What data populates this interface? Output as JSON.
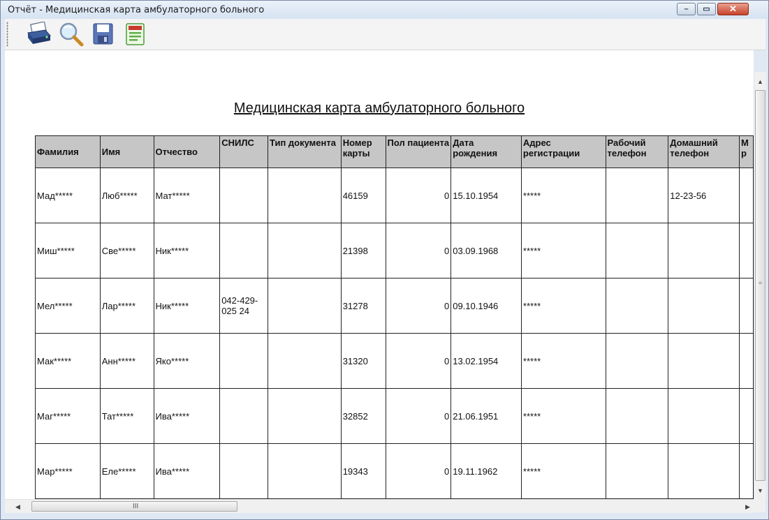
{
  "window": {
    "title": "Отчёт - Медицинская карта амбулаторного больного",
    "min_glyph": "–",
    "max_glyph": "▭",
    "close_glyph": "✕"
  },
  "toolbar": {
    "icons": [
      "printer-icon",
      "preview-magnifier-icon",
      "save-disk-icon",
      "export-document-icon"
    ]
  },
  "report": {
    "title": "Медицинская карта амбулаторного больного",
    "columns": [
      "Фамилия",
      "Имя",
      "Отчество",
      "СНИЛС",
      "Тип документа",
      "Номер карты",
      "Пол пациента",
      "Дата рождения",
      "Адрес регистрации",
      "Рабочий телефон",
      "Домашний телефон",
      "М р"
    ],
    "rows": [
      [
        "Мад*****",
        "Люб*****",
        "Мат*****",
        "",
        "",
        "46159",
        "0",
        "15.10.1954",
        "*****",
        "",
        "12-23-56",
        ""
      ],
      [
        "Миш*****",
        "Све*****",
        "Ник*****",
        "",
        "",
        "21398",
        "0",
        "03.09.1968",
        "*****",
        "",
        "",
        ""
      ],
      [
        "Мел*****",
        "Лар*****",
        "Ник*****",
        "042-429-025 24",
        "",
        "31278",
        "0",
        "09.10.1946",
        "*****",
        "",
        "",
        ""
      ],
      [
        "Мак*****",
        "Анн*****",
        "Яко*****",
        "",
        "",
        "31320",
        "0",
        "13.02.1954",
        "*****",
        "",
        "",
        ""
      ],
      [
        "Маг*****",
        "Тат*****",
        "Ива*****",
        "",
        "",
        "32852",
        "0",
        "21.06.1951",
        "*****",
        "",
        "",
        ""
      ],
      [
        "Мар*****",
        "Еле*****",
        "Ива*****",
        "",
        "",
        "19343",
        "0",
        "19.11.1962",
        "*****",
        "",
        "",
        ""
      ]
    ]
  },
  "scrollbars": {
    "up": "▲",
    "down": "▼",
    "left": "◀",
    "right": "▶",
    "h_grip": "III",
    "v_grip": "≡"
  }
}
